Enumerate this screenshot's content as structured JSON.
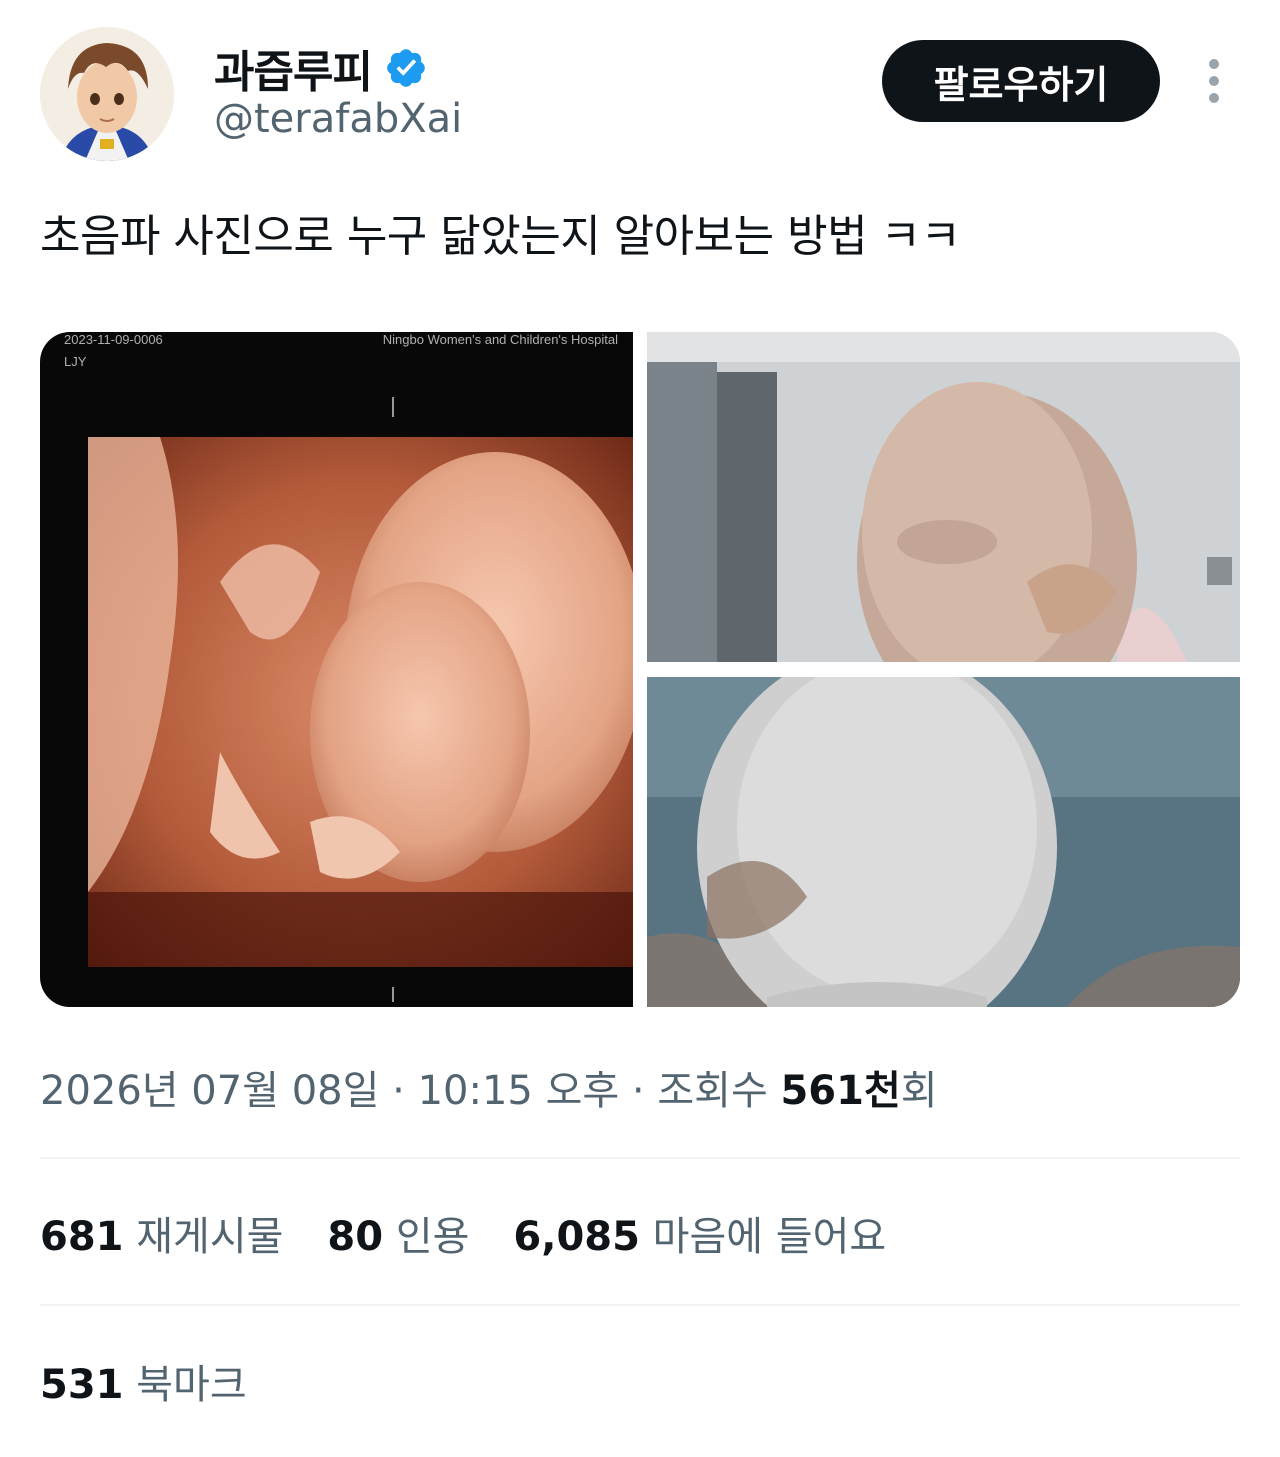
{
  "author": {
    "display_name": "과즙루피",
    "handle": "@terafabXai",
    "verified_color": "#1d9bf0"
  },
  "actions": {
    "follow_label": "팔로우하기",
    "more_icon": "more-vertical-icon"
  },
  "tweet": {
    "text": "초음파 사진으로 누구 닮았는지 알아보는 방법 ㅋㅋ"
  },
  "media": {
    "left_image": {
      "id_text": "2023-11-09-0006",
      "sub_text": "LJY",
      "hospital_text": "Ningbo Women's and Children's Hospital"
    }
  },
  "meta": {
    "date": "2026년 07월 08일",
    "separator": " · ",
    "time": "10:15 오후",
    "views_label": "조회수",
    "views_value": "561천",
    "views_suffix": "회"
  },
  "stats": {
    "retweets_value": "681",
    "retweets_label": "재게시물",
    "quotes_value": "80",
    "quotes_label": "인용",
    "likes_value": "6,085",
    "likes_label": "마음에 들어요",
    "bookmarks_value": "531",
    "bookmarks_label": "북마크"
  }
}
